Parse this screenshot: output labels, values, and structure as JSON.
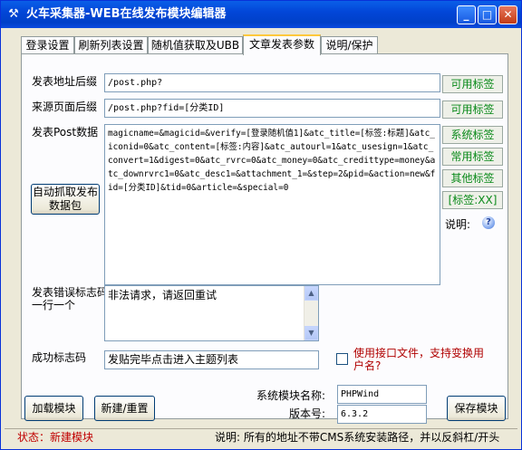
{
  "window": {
    "title": "火车采集器-WEB在线发布模块编辑器",
    "controls": {
      "minimize": "_",
      "maximize": "□",
      "close": "✕"
    }
  },
  "tabs": [
    {
      "label": "登录设置"
    },
    {
      "label": "刷新列表设置"
    },
    {
      "label": "随机值获取及UBB"
    },
    {
      "label": "文章发表参数",
      "active": true
    },
    {
      "label": "说明/保护"
    }
  ],
  "form": {
    "post_url_suffix": {
      "label": "发表地址后缀",
      "value": "/post.php?"
    },
    "referer_suffix": {
      "label": "来源页面后缀",
      "value": "/post.php?fid=[分类ID]"
    },
    "post_data": {
      "label": "发表Post数据",
      "value": "magicname=&magicid=&verify=[登录随机值1]&atc_title=[标签:标题]&atc_iconid=0&atc_content=[标签:内容]&atc_autourl=1&atc_usesign=1&atc_convert=1&digest=0&atc_rvrc=0&atc_money=0&atc_credittype=money&atc_downrvrc1=0&atc_desc1=&attachment_1=&step=2&pid=&action=new&fid=[分类ID]&tid=0&article=&special=0"
    },
    "auto_capture_button": "自动抓取发布数据包",
    "error_marker": {
      "label": "发表错误标志码\n一行一个",
      "value": "非法请求，请返回重试"
    },
    "success_marker": {
      "label": "成功标志码",
      "value": "发贴完毕点击进入主题列表"
    },
    "use_interface_file": {
      "label": "使用接口文件，支持变换用户名?",
      "checked": false
    }
  },
  "side_buttons": {
    "available_tags_1": "可用标签",
    "available_tags_2": "可用标签",
    "system_tags": "系统标签",
    "common_tags": "常用标签",
    "other_tags": "其他标签",
    "tag_xx": "[标签:XX]",
    "help_label": "说明:"
  },
  "bottom": {
    "load_module": "加载模块",
    "new_reset": "新建/重置",
    "system_module_name_label": "系统模块名称:",
    "system_module_name": "PHPWind",
    "version_label": "版本号:",
    "version": "6.3.2",
    "save_module": "保存模块"
  },
  "status": {
    "state": "状态：新建模块",
    "note": "说明:  所有的地址不带CMS系统安装路径，并以反斜杠/开头"
  },
  "colors": {
    "title_bar": "#0a4be0",
    "tag_button_text": "#0a8a1a",
    "status_state": "#c00000",
    "checkbox_label": "#b00000"
  }
}
